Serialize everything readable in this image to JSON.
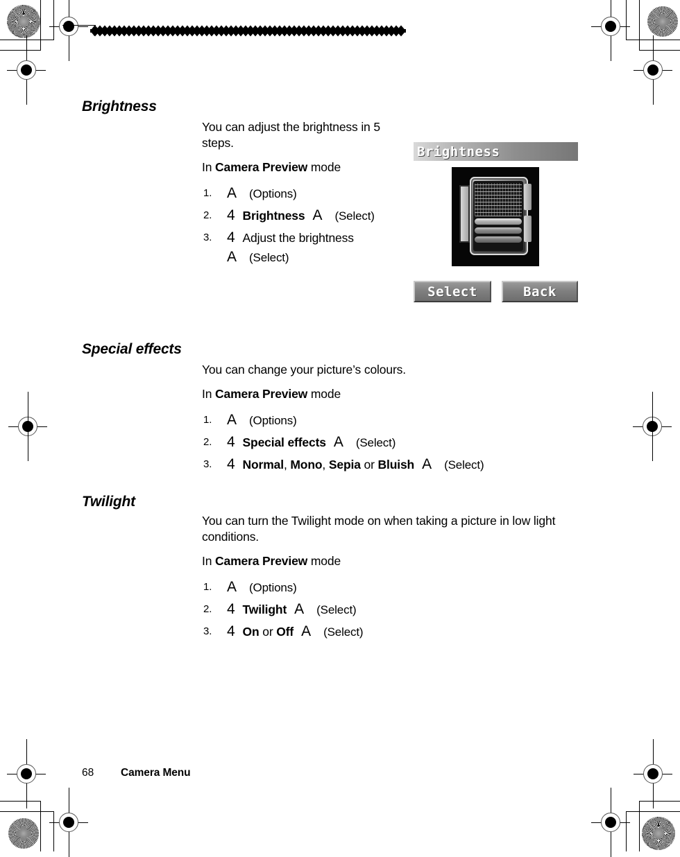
{
  "page": {
    "number": "68",
    "running_title": "Camera Menu"
  },
  "sections": [
    {
      "heading": "Brightness",
      "intro": "You can adjust the brightness in 5 steps.",
      "mode_prefix": "In ",
      "mode_name": "Camera Preview",
      "mode_suffix": " mode",
      "steps": [
        {
          "key": "A",
          "label": "",
          "action": "(Options)"
        },
        {
          "key": "4",
          "label": "Brightness",
          "key2": "A",
          "action": "(Select)"
        },
        {
          "key": "4",
          "label": "Adjust the brightness",
          "key2": "A",
          "action": "(Select)"
        }
      ]
    },
    {
      "heading": "Special effects",
      "intro": "You can change your picture’s colours.",
      "mode_prefix": "In ",
      "mode_name": "Camera Preview",
      "mode_suffix": " mode",
      "steps": [
        {
          "key": "A",
          "label": "",
          "action": "(Options)"
        },
        {
          "key": "4",
          "label": "Special effects",
          "key2": "A",
          "action": "(Select)"
        },
        {
          "key": "4",
          "options": [
            "Normal",
            "Mono",
            "Sepia",
            "Bluish"
          ],
          "separator_comma": ", ",
          "separator_or": " or ",
          "key2": "A",
          "action": "(Select)"
        }
      ]
    },
    {
      "heading": "Twilight",
      "intro": "You can turn the Twilight mode on when taking a picture in low light conditions.",
      "mode_prefix": "In ",
      "mode_name": "Camera Preview",
      "mode_suffix": " mode",
      "steps": [
        {
          "key": "A",
          "label": "",
          "action": "(Options)"
        },
        {
          "key": "4",
          "label": "Twilight",
          "key2": "A",
          "action": "(Select)"
        },
        {
          "key": "4",
          "options": [
            "On",
            "Off"
          ],
          "separator_or": " or ",
          "key2": "A",
          "action": "(Select)"
        }
      ]
    }
  ],
  "screenshot": {
    "title": "Brightness",
    "softkey_left": "Select",
    "softkey_right": "Back"
  },
  "colors": {
    "ink": "#000000",
    "paper": "#ffffff",
    "titlebar_light": "#d9d9d9",
    "titlebar_dark": "#777777",
    "softkey_fill": "#808080",
    "photo_background": "#060606"
  }
}
